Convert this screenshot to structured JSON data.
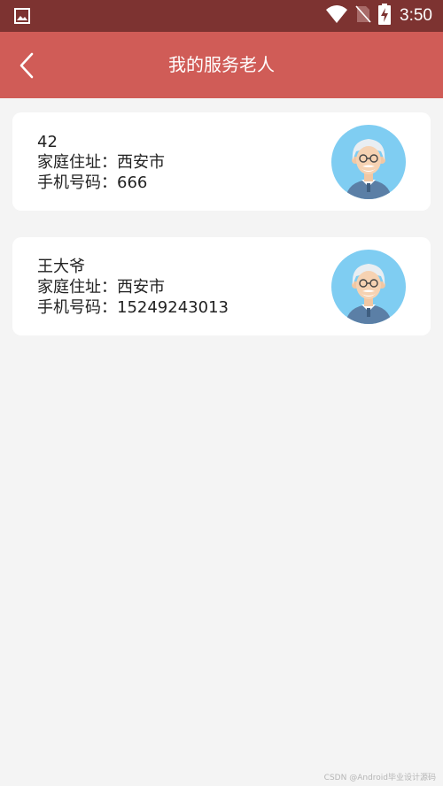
{
  "status_bar": {
    "time": "3:50",
    "icons": [
      "gallery-icon",
      "wifi-icon",
      "no-sim-icon",
      "battery-charging-icon"
    ]
  },
  "header": {
    "title": "我的服务老人",
    "back_icon": "chevron-left-icon"
  },
  "elders": [
    {
      "name": "42",
      "address": "家庭住址：西安市",
      "phone": "手机号码：666",
      "avatar": "elderly-man-avatar"
    },
    {
      "name": "王大爷",
      "address": "家庭住址：西安市",
      "phone": "手机号码：15249243013",
      "avatar": "elderly-man-avatar"
    }
  ],
  "watermark": "CSDN @Android毕业设计源码",
  "colors": {
    "status_bar": "#7d3331",
    "app_bar": "#d05c57",
    "background": "#f4f4f4",
    "card": "#ffffff",
    "avatar_bg": "#7fcdf2"
  }
}
